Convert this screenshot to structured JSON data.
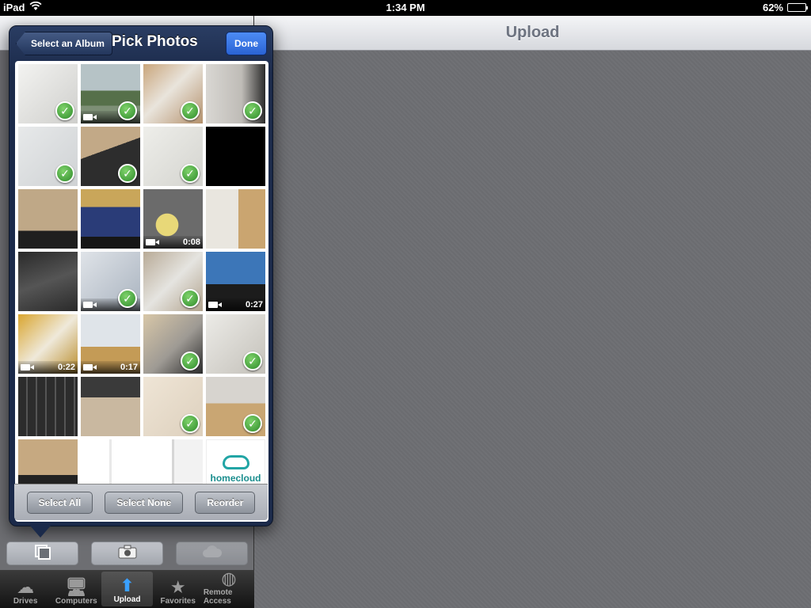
{
  "status": {
    "device": "iPad",
    "time": "1:34 PM",
    "battery": "62%",
    "battery_level": 0.62
  },
  "detail": {
    "title": "Upload"
  },
  "popover": {
    "back_label": "Select an Album",
    "title": "Pick Photos",
    "done_label": "Done",
    "footer": {
      "select_all": "Select All",
      "select_none": "Select None",
      "reorder": "Reorder"
    }
  },
  "photos": [
    {
      "bg": "linear-gradient(135deg,#f3f3f1,#cfcfcc)",
      "checked": true,
      "video": false,
      "duration": ""
    },
    {
      "bg": "linear-gradient(#b6c3c6 0 45%,#56704a 45% 70%,#7d8f76 70%)",
      "checked": true,
      "video": true,
      "duration": ""
    },
    {
      "bg": "linear-gradient(135deg,#c9a57b,#e9e4dc 45%,#b4916b)",
      "checked": true,
      "video": false,
      "duration": ""
    },
    {
      "bg": "linear-gradient(90deg,#d9d7d3,#bfbcb7 60%,#2b2b2b)",
      "checked": true,
      "video": false,
      "duration": ""
    },
    {
      "bg": "linear-gradient(135deg,#e7e9ea,#cfd2d4)",
      "checked": true,
      "video": false,
      "duration": ""
    },
    {
      "bg": "linear-gradient(160deg,#c2a987 0 40%,#2d2d2d 40%)",
      "checked": true,
      "video": false,
      "duration": ""
    },
    {
      "bg": "linear-gradient(135deg,#eeeeea,#d4d4cf)",
      "checked": true,
      "video": false,
      "duration": ""
    },
    {
      "bg": "#000000",
      "checked": false,
      "video": false,
      "duration": ""
    },
    {
      "bg": "linear-gradient(#bfa887 0 70%,#1f1f1f 70%)",
      "checked": false,
      "video": false,
      "duration": ""
    },
    {
      "bg": "linear-gradient(#c9a65a 0 30%,#2a3c78 30% 80%,#161616 80%)",
      "checked": false,
      "video": false,
      "duration": ""
    },
    {
      "bg": "radial-gradient(circle at 40% 60%,#e8d878 0 22%,#6b6b6b 23%)",
      "checked": false,
      "video": true,
      "duration": "0:08"
    },
    {
      "bg": "linear-gradient(90deg,#e9e6df 0 55%,#caa570 55%)",
      "checked": false,
      "video": false,
      "duration": ""
    },
    {
      "bg": "linear-gradient(160deg,#2a2a2a,#555 50%,#2a2a2a)",
      "checked": false,
      "video": false,
      "duration": ""
    },
    {
      "bg": "linear-gradient(135deg,#dfe3e8,#a9b3bf)",
      "checked": true,
      "video": true,
      "duration": ""
    },
    {
      "bg": "linear-gradient(135deg,#b8aa96,#e5e4e0 50%,#b1a28c)",
      "checked": true,
      "video": false,
      "duration": ""
    },
    {
      "bg": "linear-gradient(#3c76b8 0 55%,#1c1c1c 55%)",
      "checked": false,
      "video": true,
      "duration": "0:27"
    },
    {
      "bg": "linear-gradient(135deg,#d9a52f,#efe9da 50%,#b98c2b)",
      "checked": false,
      "video": true,
      "duration": "0:22"
    },
    {
      "bg": "linear-gradient(#dfe4e9 0 55%,#c49b56 55%)",
      "checked": false,
      "video": true,
      "duration": "0:17"
    },
    {
      "bg": "linear-gradient(135deg,#d8c7a8,#9e9a94 55%,#2b2b2b)",
      "checked": true,
      "video": false,
      "duration": ""
    },
    {
      "bg": "linear-gradient(135deg,#ecebe7,#c4c1ba)",
      "checked": true,
      "video": false,
      "duration": ""
    },
    {
      "bg": "repeating-linear-gradient(90deg,#2c2c2c 0 10px,#555 10px 12px)",
      "checked": false,
      "video": false,
      "duration": ""
    },
    {
      "bg": "linear-gradient(#3a3a3a 0 35%,#c9b8a0 35%)",
      "checked": false,
      "video": false,
      "duration": ""
    },
    {
      "bg": "linear-gradient(135deg,#efe5d6,#ddd0bd)",
      "checked": true,
      "video": false,
      "duration": ""
    },
    {
      "bg": "linear-gradient(#d7d4cf 0 45%,#c9a673 45%)",
      "checked": true,
      "video": false,
      "duration": ""
    },
    {
      "bg": "linear-gradient(#c6a981 0 60%,#222 60%)",
      "checked": false,
      "video": false,
      "duration": ""
    },
    {
      "bg": "linear-gradient(90deg,#ffffff 0 48%,#e9e9e9 48% 52%,#ffffff 52%)",
      "checked": false,
      "video": false,
      "duration": ""
    },
    {
      "bg": "linear-gradient(90deg,#ffffff 0 48%,#d6d6d6 48% 52%,#f2f2f2 52%)",
      "checked": false,
      "video": false,
      "duration": ""
    },
    {
      "logo": true,
      "logo_text": "homecloud",
      "checked": false,
      "video": false,
      "duration": ""
    }
  ],
  "toolbar": {
    "library_icon": "photo-library-icon",
    "camera_icon": "camera-icon",
    "cloud_icon": "cloud-icon"
  },
  "tabs": [
    {
      "label": "Drives",
      "icon": "cloud-icon",
      "glyph": "☁",
      "active": false
    },
    {
      "label": "Computers",
      "icon": "monitor-icon",
      "glyph": "🖥",
      "active": false
    },
    {
      "label": "Upload",
      "icon": "upload-icon",
      "glyph": "⬆",
      "active": true
    },
    {
      "label": "Favorites",
      "icon": "star-icon",
      "glyph": "★",
      "active": false
    },
    {
      "label": "Remote Access",
      "icon": "globe-icon",
      "glyph": "◍",
      "active": false
    }
  ],
  "colors": {
    "accent": "#2a63d4",
    "check": "#2e8a2a",
    "brand_teal": "#22a5a5"
  }
}
